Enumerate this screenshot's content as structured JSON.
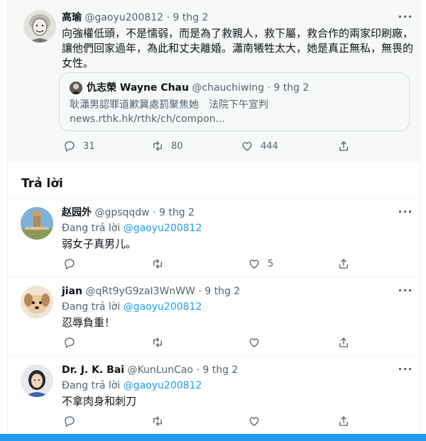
{
  "main_tweet": {
    "name": "高瑜",
    "handle": "@gaoyu200812",
    "separator": "·",
    "date": "9 thg 2",
    "text_line1": "向強權低頭，不是懦弱，而是為了救親人，救下屬，救合作的兩家印刷廠，",
    "text_line2": "讓他們回家過年，為此和丈夫離婚。瀟南犧牲太大，她是真正無私，無畏的",
    "text_line3": "女性。",
    "quote": {
      "name": "仇志榮 Wayne Chau",
      "handle": "@chauchiwing",
      "date": "9 thg 2",
      "text": "耿瀟男認罪道歉冀處罰聚焦她　法院下午宣判",
      "link": "news.rthk.hk/rthk/ch/compon..."
    },
    "reply_count": "31",
    "retweet_count": "80",
    "like_count": "444"
  },
  "replies_title": "Trả lời",
  "replies": [
    {
      "name": "赵园外",
      "handle": "@gpsqqdw",
      "date": "9 thg 2",
      "replying_label": "Đang trả lời",
      "replying_to": "@gaoyu200812",
      "text": "弱女子真男儿。",
      "like_count": "5"
    },
    {
      "name": "jian",
      "handle": "@qRt9yG9zaI3WnWW",
      "date": "9 thg 2",
      "replying_label": "Đang trả lời",
      "replying_to": "@gaoyu200812",
      "text": "忍辱負重！",
      "like_count": ""
    },
    {
      "name": "Dr. J. K. Bai",
      "handle": "@KunLunCao",
      "date": "9 thg 2",
      "replying_label": "Đang trả lời",
      "replying_to": "@gaoyu200812",
      "text": "不拿肉身和刺刀",
      "like_count": ""
    }
  ],
  "colors": {
    "accent": "#1d9bf0",
    "muted": "#536471",
    "highlight_bg": "#f7f9f9"
  },
  "icons": {
    "more": "more-horizontal-icon",
    "reply": "reply-icon",
    "retweet": "retweet-icon",
    "like": "like-icon",
    "share": "share-icon"
  }
}
